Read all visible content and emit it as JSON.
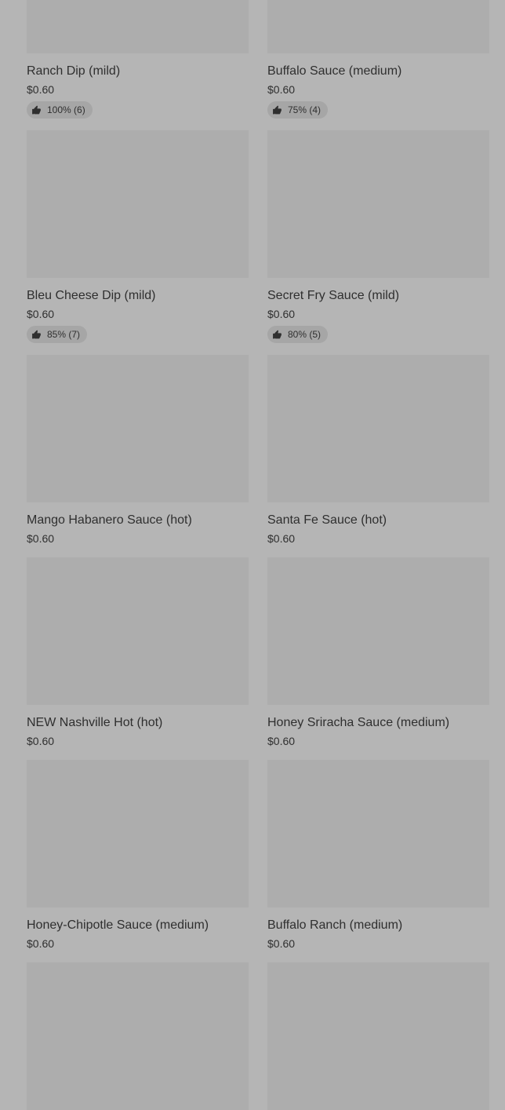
{
  "colors": {
    "page_background": "#b5b5b5",
    "image_placeholder": "#adadad",
    "text": "#2f2f2f",
    "rating_badge": "#a6a6a6"
  },
  "menu": {
    "items": [
      {
        "name": "Ranch Dip (mild)",
        "price": "$0.60",
        "rating": "100% (6)",
        "rating_icon": "thumbs-up-icon"
      },
      {
        "name": "Buffalo Sauce (medium)",
        "price": "$0.60",
        "rating": "75% (4)",
        "rating_icon": "thumbs-up-icon"
      },
      {
        "name": "Bleu Cheese Dip (mild)",
        "price": "$0.60",
        "rating": "85% (7)",
        "rating_icon": "thumbs-up-icon"
      },
      {
        "name": "Secret Fry Sauce (mild)",
        "price": "$0.60",
        "rating": "80% (5)",
        "rating_icon": "thumbs-up-icon"
      },
      {
        "name": "Mango Habanero Sauce (hot)",
        "price": "$0.60"
      },
      {
        "name": "Santa Fe Sauce (hot)",
        "price": "$0.60"
      },
      {
        "name": "NEW Nashville Hot (hot)",
        "price": "$0.60"
      },
      {
        "name": "Honey Sriracha Sauce (medium)",
        "price": "$0.60"
      },
      {
        "name": "Honey-Chipotle Sauce (medium)",
        "price": "$0.60"
      },
      {
        "name": "Buffalo Ranch (medium)",
        "price": "$0.60"
      },
      {},
      {}
    ]
  }
}
